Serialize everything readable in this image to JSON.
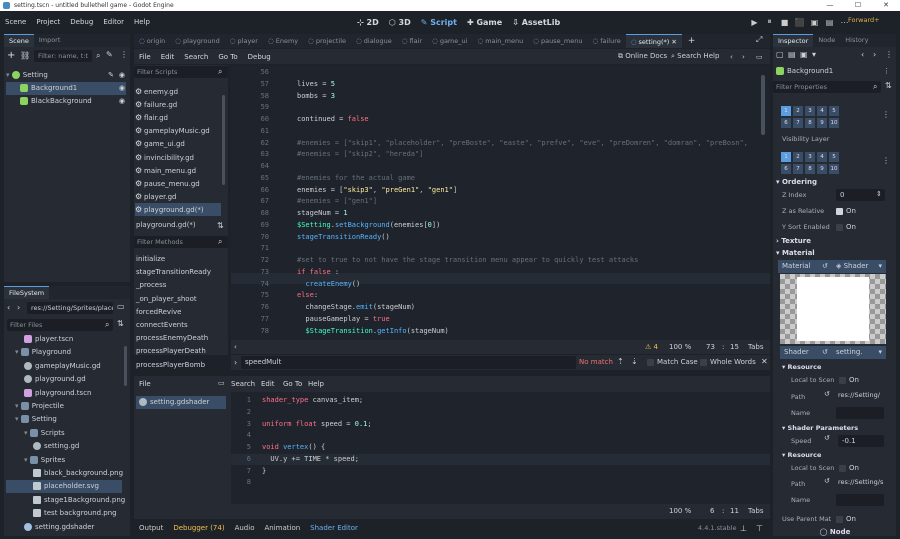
{
  "window": {
    "title": "setting.tscn - untitled bullethell game - Godot Engine",
    "controls": [
      "—",
      "☐",
      "✕"
    ]
  },
  "menu": [
    "Scene",
    "Project",
    "Debug",
    "Editor",
    "Help"
  ],
  "main_screens": [
    {
      "label": "2D",
      "icon": "2d-icon"
    },
    {
      "label": "3D",
      "icon": "3d-icon"
    },
    {
      "label": "Script",
      "icon": "script-icon",
      "active": true
    },
    {
      "label": "Game",
      "icon": "game-icon"
    },
    {
      "label": "AssetLib",
      "icon": "assetlib-icon"
    }
  ],
  "run_controls": [
    "▶",
    "⏸",
    "■",
    "⬛",
    "▣",
    "▤",
    "⋯",
    "⋮"
  ],
  "renderer": "Forward+",
  "scene_dock": {
    "tabs": [
      "Scene",
      "Import"
    ],
    "filter_placeholder": "Filter: name, t:t",
    "tree": [
      {
        "label": "Setting",
        "indent": 0
      },
      {
        "label": "Background1",
        "indent": 1,
        "selected": true
      },
      {
        "label": "BlackBackground",
        "indent": 1
      }
    ]
  },
  "filesystem": {
    "tab": "FileSystem",
    "path": "res://Setting/Sprites/place",
    "filter_placeholder": "Filter Files",
    "items": [
      {
        "label": "player.tscn",
        "indent": 2,
        "type": "scene"
      },
      {
        "label": "Playground",
        "indent": 1,
        "type": "folder"
      },
      {
        "label": "gameplayMusic.gd",
        "indent": 2,
        "type": "script"
      },
      {
        "label": "playground.gd",
        "indent": 2,
        "type": "script"
      },
      {
        "label": "playground.tscn",
        "indent": 2,
        "type": "scene"
      },
      {
        "label": "Projectile",
        "indent": 1,
        "type": "folder"
      },
      {
        "label": "Setting",
        "indent": 1,
        "type": "folder"
      },
      {
        "label": "Scripts",
        "indent": 2,
        "type": "folder"
      },
      {
        "label": "setting.gd",
        "indent": 3,
        "type": "script"
      },
      {
        "label": "Sprites",
        "indent": 2,
        "type": "folder"
      },
      {
        "label": "black_background.png",
        "indent": 3,
        "type": "image"
      },
      {
        "label": "placeholder.svg",
        "indent": 3,
        "type": "image",
        "selected": true
      },
      {
        "label": "stage1Background.png",
        "indent": 3,
        "type": "image"
      },
      {
        "label": "test background.png",
        "indent": 3,
        "type": "image"
      },
      {
        "label": "setting.gdshader",
        "indent": 2,
        "type": "shader"
      }
    ]
  },
  "script_tabs": [
    {
      "label": "origin"
    },
    {
      "label": "playground"
    },
    {
      "label": "player"
    },
    {
      "label": "Enemy"
    },
    {
      "label": "projectile"
    },
    {
      "label": "dialogue"
    },
    {
      "label": "flair"
    },
    {
      "label": "game_ui"
    },
    {
      "label": "main_menu"
    },
    {
      "label": "pause_menu"
    },
    {
      "label": "failure"
    },
    {
      "label": "setting(*)",
      "active": true
    }
  ],
  "script_menu": [
    "File",
    "Edit",
    "Search",
    "Go To",
    "Debug"
  ],
  "online_docs": "Online Docs",
  "search_help": "Search Help",
  "filter_scripts": "Filter Scripts",
  "scripts_list": [
    "enemy.gd",
    "failure.gd",
    "flair.gd",
    "gameplayMusic.gd",
    "game_ui.gd",
    "invincibility.gd",
    "main_menu.gd",
    "pause_menu.gd",
    "player.gd",
    "playground.gd(*)"
  ],
  "current_script": "playground.gd(*)",
  "filter_methods": "Filter Methods",
  "methods_list": [
    "initialize",
    "stageTransitionReady",
    "_process",
    "_on_player_shoot",
    "forcedRevive",
    "connectEvents",
    "processEnemyDeath",
    "processPlayerDeath",
    "processPlayerBomb"
  ],
  "code_lines": [
    {
      "n": "56",
      "t": []
    },
    {
      "n": "57",
      "t": [
        [
          "plain",
          "lives = "
        ],
        [
          "num",
          "5"
        ]
      ]
    },
    {
      "n": "58",
      "t": [
        [
          "plain",
          "bombs = "
        ],
        [
          "num",
          "3"
        ]
      ]
    },
    {
      "n": "59",
      "t": []
    },
    {
      "n": "60",
      "t": [
        [
          "plain",
          "continued = "
        ],
        [
          "kw",
          "false"
        ]
      ]
    },
    {
      "n": "61",
      "t": []
    },
    {
      "n": "62",
      "t": [
        [
          "cm",
          "#enemies = [\"skip1\", \"placeholder\", \"preBoste\", \"easte\", \"prefve\", \"eve\", \"preDomren\", \"domran\", \"preBosn\","
        ]
      ]
    },
    {
      "n": "63",
      "t": [
        [
          "cm",
          "#enemies = [\"skip2\", \"hereda\"]"
        ]
      ]
    },
    {
      "n": "64",
      "t": []
    },
    {
      "n": "65",
      "t": [
        [
          "cm",
          "#enemies for the actual game"
        ]
      ]
    },
    {
      "n": "66",
      "t": [
        [
          "plain",
          "enemies = ["
        ],
        [
          "str",
          "\"skip3\""
        ],
        [
          "plain",
          ", "
        ],
        [
          "str",
          "\"preGen1\""
        ],
        [
          "plain",
          ", "
        ],
        [
          "str",
          "\"gen1\""
        ],
        [
          "plain",
          "]"
        ]
      ]
    },
    {
      "n": "67",
      "t": [
        [
          "cm",
          "#enemies = [\"gen1\"]"
        ]
      ]
    },
    {
      "n": "68",
      "t": [
        [
          "plain",
          "stageNum = "
        ],
        [
          "num",
          "1"
        ]
      ]
    },
    {
      "n": "69",
      "t": [
        [
          "cls",
          "$Setting"
        ],
        [
          "plain",
          "."
        ],
        [
          "fn",
          "setBackground"
        ],
        [
          "plain",
          "(enemies["
        ],
        [
          "num",
          "0"
        ],
        [
          "plain",
          "])"
        ]
      ]
    },
    {
      "n": "70",
      "t": [
        [
          "fn",
          "stageTransitionReady"
        ],
        [
          "plain",
          "()"
        ]
      ]
    },
    {
      "n": "71",
      "t": []
    },
    {
      "n": "72",
      "t": [
        [
          "cm",
          "#set to true to not have the stage transition menu appear to quickly test attacks"
        ]
      ]
    },
    {
      "n": "73",
      "t": [
        [
          "kw",
          "if false"
        ],
        [
          "plain",
          " :"
        ]
      ]
    },
    {
      "n": "74",
      "t": [
        [
          "plain",
          "  "
        ],
        [
          "fn",
          "createEnemy"
        ],
        [
          "plain",
          "()"
        ]
      ]
    },
    {
      "n": "75",
      "t": [
        [
          "kw",
          "else"
        ],
        [
          "plain",
          ":"
        ]
      ]
    },
    {
      "n": "76",
      "t": [
        [
          "plain",
          "  changeStage."
        ],
        [
          "fn",
          "emit"
        ],
        [
          "plain",
          "(stageNum)"
        ]
      ]
    },
    {
      "n": "77",
      "t": [
        [
          "plain",
          "  pauseGameplay = "
        ],
        [
          "kw",
          "true"
        ]
      ]
    },
    {
      "n": "78",
      "t": [
        [
          "plain",
          "  "
        ],
        [
          "cls",
          "$StageTransition"
        ],
        [
          "plain",
          "."
        ],
        [
          "fn",
          "getInfo"
        ],
        [
          "plain",
          "(stageNum)"
        ]
      ]
    }
  ],
  "editor_status": {
    "warnings": "4",
    "zoom": "100 %",
    "line": "73",
    "col": "15",
    "indent": "Tabs"
  },
  "find": {
    "value": "speedMult",
    "result": "No match",
    "match_case": "Match Case",
    "whole_words": "Whole Words"
  },
  "shader_menu": [
    "File",
    "Search",
    "Edit",
    "Go To",
    "Help"
  ],
  "shader_files": [
    "setting.gdshader"
  ],
  "shader_lines": [
    {
      "n": "1",
      "t": [
        [
          "kw",
          "shader_type"
        ],
        [
          "plain",
          " canvas_item;"
        ]
      ]
    },
    {
      "n": "2",
      "t": []
    },
    {
      "n": "3",
      "t": [
        [
          "kw",
          "uniform float"
        ],
        [
          "plain",
          " speed = "
        ],
        [
          "num",
          "0.1"
        ],
        [
          "plain",
          ";"
        ]
      ]
    },
    {
      "n": "4",
      "t": []
    },
    {
      "n": "5",
      "t": [
        [
          "kw",
          "void"
        ],
        [
          "plain",
          " "
        ],
        [
          "fn",
          "vertex"
        ],
        [
          "plain",
          "() {"
        ]
      ]
    },
    {
      "n": "6",
      "t": [
        [
          "plain",
          "  UV.y += TIME * speed;"
        ]
      ]
    },
    {
      "n": "7",
      "t": [
        [
          "plain",
          "}"
        ]
      ]
    },
    {
      "n": "8",
      "t": []
    }
  ],
  "shader_status": {
    "zoom": "100 %",
    "line": "6",
    "col": "11",
    "indent": "Tabs"
  },
  "bottom_tabs": [
    "Output",
    "Debugger (74)",
    "Audio",
    "Animation",
    "Shader Editor"
  ],
  "version": "4.4.1.stable",
  "inspector": {
    "tabs": [
      "Inspector",
      "Node",
      "History"
    ],
    "object": "Background1",
    "filter_placeholder": "Filter Properties",
    "layers_1": [
      "1",
      "2",
      "3",
      "4",
      "5",
      "6",
      "7",
      "8",
      "9",
      "10"
    ],
    "visibility_layer": "Visibility Layer",
    "layers_2": [
      "1",
      "2",
      "3",
      "4",
      "5",
      "6",
      "7",
      "8",
      "9",
      "10"
    ],
    "ordering": "Ordering",
    "z_index_label": "Z Index",
    "z_index": "0",
    "z_relative_label": "Z as Relative",
    "z_relative": "On",
    "y_sort_label": "Y Sort Enabled",
    "y_sort": "On",
    "texture": "Texture",
    "material": "Material",
    "material_label": "Material",
    "material_value": "Shader",
    "shader_label": "Shader",
    "shader_value": "setting.",
    "resource": "Resource",
    "local_to_scene": "Local to Scen",
    "local_on": "On",
    "path_label": "Path",
    "path_value": "res://Setting/",
    "name_label": "Name",
    "shader_params": "Shader Parameters",
    "speed_label": "Speed",
    "speed_value": "-0.1",
    "resource2": "Resource",
    "local_to_scene2": "Local to Scen",
    "local_on2": "On",
    "path_label2": "Path",
    "path_value2": "res://Setting/s",
    "name_label2": "Name",
    "use_parent_label": "Use Parent Mat",
    "use_parent": "On",
    "node_section": "Node"
  }
}
